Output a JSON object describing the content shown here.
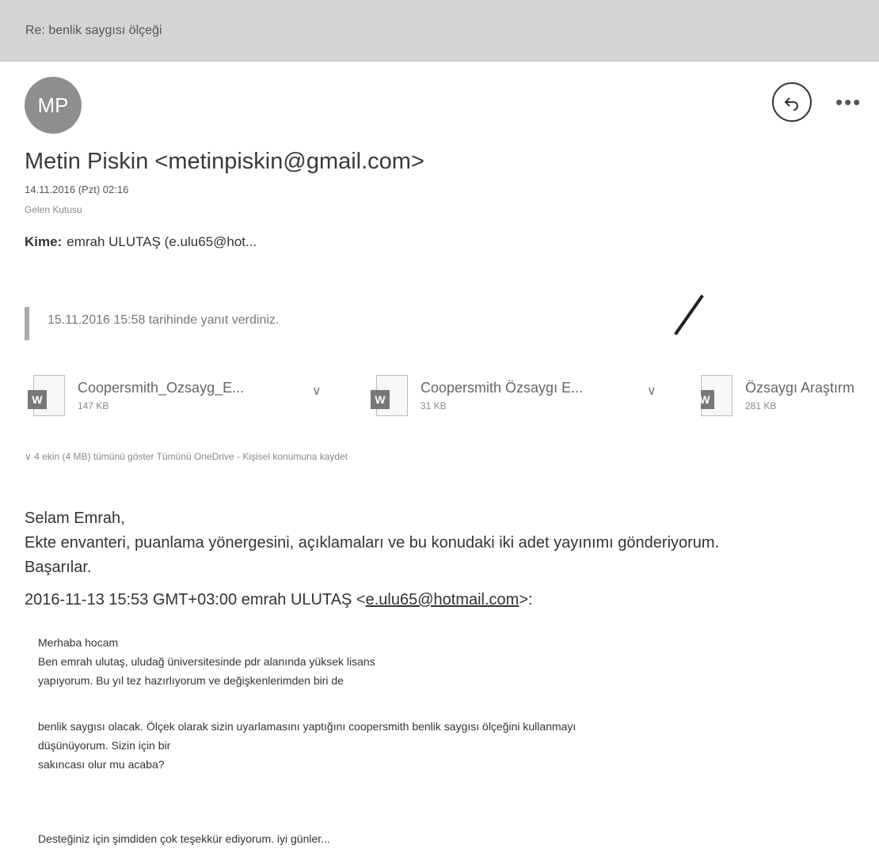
{
  "subject": "Re: benlik saygısı ölçeği",
  "avatar_initials": "MP",
  "sender": "Metin Piskin <metinpiskin@gmail.com>",
  "date": "14.11.2016 (Pzt) 02:16",
  "folder": "Gelen Kutusu",
  "to_label": "Kime:",
  "to_value": "emrah ULUTAŞ (e.ulu65@hot...",
  "reply_note": "15.11.2016 15:58 tarihinde yanıt verdiniz.",
  "attachments": [
    {
      "name": "Coopersmith_Ozsayg_E...",
      "size": "147 KB"
    },
    {
      "name": "Coopersmith Özsaygı E...",
      "size": "31 KB"
    },
    {
      "name": "Özsaygı Araştırm",
      "size": "281 KB"
    }
  ],
  "attachment_summary": "4 ekin (4 MB) tümünü göster   Tümünü OneDrive - Kişisel konumuna kaydet",
  "body": {
    "greeting": "Selam Emrah,",
    "line1": "Ekte envanteri, puanlama yönergesini, açıklamaları ve bu konudaki iki adet yayınımı gönderiyorum.",
    "line2": "Başarılar."
  },
  "quote_header": {
    "prefix": "2016-11-13 15:53 GMT+03:00 emrah ULUTAŞ <",
    "email": "e.ulu65@hotmail.com",
    "suffix": ">:"
  },
  "quoted_lines": {
    "p1": [
      "Merhaba hocam",
      "Ben emrah ulutaş, uludağ üniversitesinde pdr alanında yüksek lisans",
      "yapıyorum. Bu yıl tez hazırlıyorum ve değişkenlerimden biri de"
    ],
    "p2": [
      " benlik saygısı olacak. Ölçek olarak sizin uyarlamasını yaptığını coopersmith benlik saygısı ölçeğini kullanmayı",
      "düşünüyorum. Sizin için bir",
      "sakıncası olur mu acaba?"
    ],
    "p3": [
      "Desteğiniz için şimdiden çok teşekkür ediyorum. iyi günler..."
    ]
  },
  "icons": {
    "reply": "reply-arrow-icon",
    "more": "more-dots-icon",
    "doc": "word-document-icon",
    "chevron": "chevron-down-icon"
  }
}
